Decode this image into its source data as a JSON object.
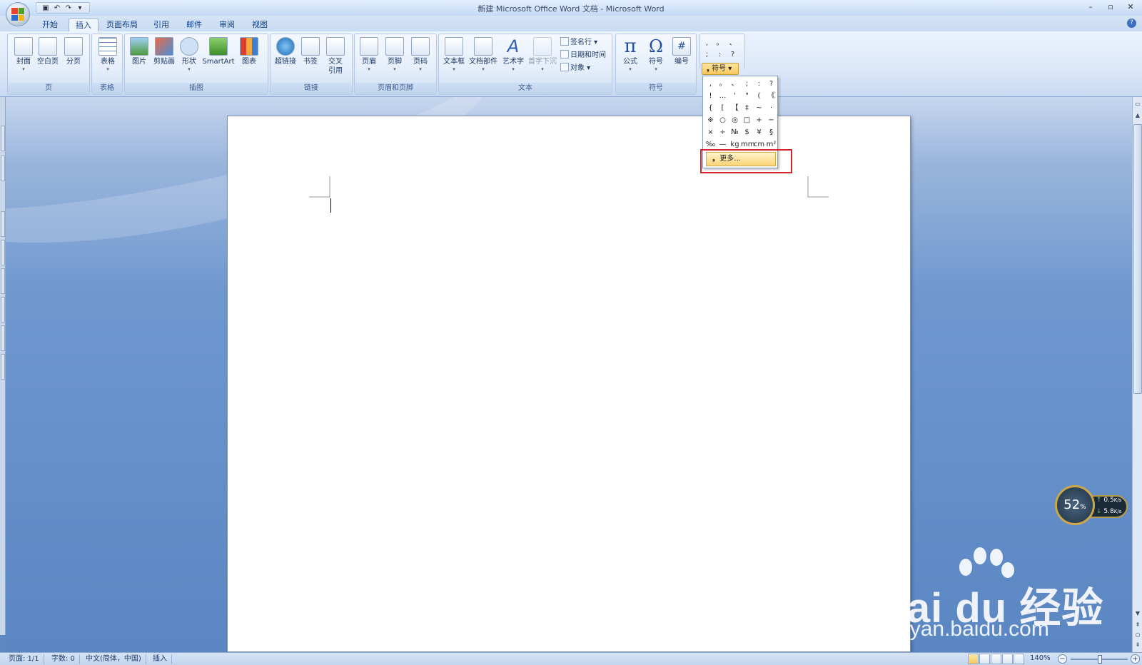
{
  "window": {
    "title": "新建 Microsoft Office Word 文档 - Microsoft Word",
    "controls": [
      "–",
      "▫",
      "✕"
    ]
  },
  "tabs": [
    {
      "label": "开始",
      "active": false
    },
    {
      "label": "插入",
      "active": true
    },
    {
      "label": "页面布局",
      "active": false
    },
    {
      "label": "引用",
      "active": false
    },
    {
      "label": "邮件",
      "active": false
    },
    {
      "label": "审阅",
      "active": false
    },
    {
      "label": "视图",
      "active": false
    }
  ],
  "ribbon": {
    "groups": {
      "pages": {
        "label": "页",
        "buttons": [
          "封面",
          "空白页",
          "分页"
        ]
      },
      "tables": {
        "label": "表格",
        "buttons": [
          "表格"
        ]
      },
      "illustrations": {
        "label": "插图",
        "buttons": [
          "图片",
          "剪贴画",
          "形状",
          "SmartArt",
          "图表"
        ]
      },
      "links": {
        "label": "链接",
        "buttons": [
          "超链接",
          "书签",
          "交叉\n引用"
        ]
      },
      "header_footer": {
        "label": "页眉和页脚",
        "buttons": [
          "页眉",
          "页脚",
          "页码"
        ]
      },
      "text": {
        "label": "文本",
        "buttons": [
          "文本框",
          "文档部件",
          "艺术字",
          "首字下沉"
        ],
        "small": [
          "签名行",
          "日期和时间",
          "对象"
        ]
      },
      "symbols": {
        "label": "符号",
        "buttons": [
          "公式",
          "符号",
          "编号"
        ]
      }
    },
    "icon_glyphs": {
      "formula": "π",
      "symbol": "Ω",
      "number": "#"
    }
  },
  "special_symbols": {
    "mini_rows": [
      [
        ",",
        "。",
        "、"
      ],
      [
        ";",
        ":",
        "?"
      ]
    ],
    "button_label": "符号",
    "panel_symbols": [
      ",",
      "。",
      "、",
      ";",
      ":",
      "?",
      "!",
      "…",
      "'",
      "\"",
      "(",
      "《",
      "{",
      "[",
      "【",
      "‡",
      "~",
      "·",
      "※",
      "○",
      "◎",
      "□",
      "+",
      "−",
      "×",
      "÷",
      "№",
      "$",
      "¥",
      "§",
      "‰",
      "—",
      "kg",
      "mm",
      "cm",
      "m²"
    ],
    "more_label": "更多..."
  },
  "status_bar": {
    "page": "页面: 1/1",
    "words": "字数: 0",
    "language": "中文(简体，中国)",
    "mode": "插入",
    "zoom": "140%"
  },
  "net_widget": {
    "percent": "52",
    "percent_unit": "%",
    "upload": "0.5",
    "download": "5.8",
    "unit": "K/s"
  },
  "watermark": {
    "main": "Bai du 经验",
    "sub": "jingyan.baidu.com"
  }
}
